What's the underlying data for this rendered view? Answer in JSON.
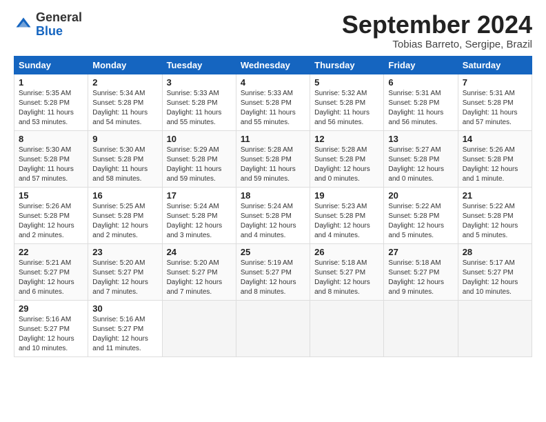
{
  "header": {
    "logo_general": "General",
    "logo_blue": "Blue",
    "month_title": "September 2024",
    "location": "Tobias Barreto, Sergipe, Brazil"
  },
  "weekdays": [
    "Sunday",
    "Monday",
    "Tuesday",
    "Wednesday",
    "Thursday",
    "Friday",
    "Saturday"
  ],
  "weeks": [
    [
      {
        "day": "1",
        "info": "Sunrise: 5:35 AM\nSunset: 5:28 PM\nDaylight: 11 hours\nand 53 minutes."
      },
      {
        "day": "2",
        "info": "Sunrise: 5:34 AM\nSunset: 5:28 PM\nDaylight: 11 hours\nand 54 minutes."
      },
      {
        "day": "3",
        "info": "Sunrise: 5:33 AM\nSunset: 5:28 PM\nDaylight: 11 hours\nand 55 minutes."
      },
      {
        "day": "4",
        "info": "Sunrise: 5:33 AM\nSunset: 5:28 PM\nDaylight: 11 hours\nand 55 minutes."
      },
      {
        "day": "5",
        "info": "Sunrise: 5:32 AM\nSunset: 5:28 PM\nDaylight: 11 hours\nand 56 minutes."
      },
      {
        "day": "6",
        "info": "Sunrise: 5:31 AM\nSunset: 5:28 PM\nDaylight: 11 hours\nand 56 minutes."
      },
      {
        "day": "7",
        "info": "Sunrise: 5:31 AM\nSunset: 5:28 PM\nDaylight: 11 hours\nand 57 minutes."
      }
    ],
    [
      {
        "day": "8",
        "info": "Sunrise: 5:30 AM\nSunset: 5:28 PM\nDaylight: 11 hours\nand 57 minutes."
      },
      {
        "day": "9",
        "info": "Sunrise: 5:30 AM\nSunset: 5:28 PM\nDaylight: 11 hours\nand 58 minutes."
      },
      {
        "day": "10",
        "info": "Sunrise: 5:29 AM\nSunset: 5:28 PM\nDaylight: 11 hours\nand 59 minutes."
      },
      {
        "day": "11",
        "info": "Sunrise: 5:28 AM\nSunset: 5:28 PM\nDaylight: 11 hours\nand 59 minutes."
      },
      {
        "day": "12",
        "info": "Sunrise: 5:28 AM\nSunset: 5:28 PM\nDaylight: 12 hours\nand 0 minutes."
      },
      {
        "day": "13",
        "info": "Sunrise: 5:27 AM\nSunset: 5:28 PM\nDaylight: 12 hours\nand 0 minutes."
      },
      {
        "day": "14",
        "info": "Sunrise: 5:26 AM\nSunset: 5:28 PM\nDaylight: 12 hours\nand 1 minute."
      }
    ],
    [
      {
        "day": "15",
        "info": "Sunrise: 5:26 AM\nSunset: 5:28 PM\nDaylight: 12 hours\nand 2 minutes."
      },
      {
        "day": "16",
        "info": "Sunrise: 5:25 AM\nSunset: 5:28 PM\nDaylight: 12 hours\nand 2 minutes."
      },
      {
        "day": "17",
        "info": "Sunrise: 5:24 AM\nSunset: 5:28 PM\nDaylight: 12 hours\nand 3 minutes."
      },
      {
        "day": "18",
        "info": "Sunrise: 5:24 AM\nSunset: 5:28 PM\nDaylight: 12 hours\nand 4 minutes."
      },
      {
        "day": "19",
        "info": "Sunrise: 5:23 AM\nSunset: 5:28 PM\nDaylight: 12 hours\nand 4 minutes."
      },
      {
        "day": "20",
        "info": "Sunrise: 5:22 AM\nSunset: 5:28 PM\nDaylight: 12 hours\nand 5 minutes."
      },
      {
        "day": "21",
        "info": "Sunrise: 5:22 AM\nSunset: 5:28 PM\nDaylight: 12 hours\nand 5 minutes."
      }
    ],
    [
      {
        "day": "22",
        "info": "Sunrise: 5:21 AM\nSunset: 5:27 PM\nDaylight: 12 hours\nand 6 minutes."
      },
      {
        "day": "23",
        "info": "Sunrise: 5:20 AM\nSunset: 5:27 PM\nDaylight: 12 hours\nand 7 minutes."
      },
      {
        "day": "24",
        "info": "Sunrise: 5:20 AM\nSunset: 5:27 PM\nDaylight: 12 hours\nand 7 minutes."
      },
      {
        "day": "25",
        "info": "Sunrise: 5:19 AM\nSunset: 5:27 PM\nDaylight: 12 hours\nand 8 minutes."
      },
      {
        "day": "26",
        "info": "Sunrise: 5:18 AM\nSunset: 5:27 PM\nDaylight: 12 hours\nand 8 minutes."
      },
      {
        "day": "27",
        "info": "Sunrise: 5:18 AM\nSunset: 5:27 PM\nDaylight: 12 hours\nand 9 minutes."
      },
      {
        "day": "28",
        "info": "Sunrise: 5:17 AM\nSunset: 5:27 PM\nDaylight: 12 hours\nand 10 minutes."
      }
    ],
    [
      {
        "day": "29",
        "info": "Sunrise: 5:16 AM\nSunset: 5:27 PM\nDaylight: 12 hours\nand 10 minutes."
      },
      {
        "day": "30",
        "info": "Sunrise: 5:16 AM\nSunset: 5:27 PM\nDaylight: 12 hours\nand 11 minutes."
      },
      {
        "day": "",
        "info": ""
      },
      {
        "day": "",
        "info": ""
      },
      {
        "day": "",
        "info": ""
      },
      {
        "day": "",
        "info": ""
      },
      {
        "day": "",
        "info": ""
      }
    ]
  ]
}
